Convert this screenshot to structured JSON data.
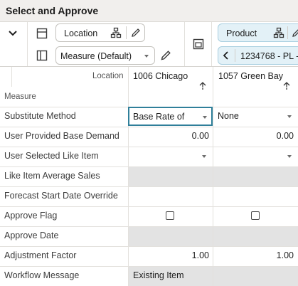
{
  "title": "Select and Approve",
  "toolbar": {
    "location_label": "Location",
    "measure_label": "Measure (Default)",
    "product_label": "Product",
    "product_value": "1234768 - PL -"
  },
  "grid": {
    "corner": {
      "location": "Location",
      "measure": "Measure"
    },
    "columns": [
      {
        "name": "1006 Chicago"
      },
      {
        "name": "1057 Green Bay"
      }
    ],
    "rows": {
      "substitute_method": {
        "label": "Substitute Method",
        "c1": "Base Rate of",
        "c2": "None"
      },
      "user_base_demand": {
        "label": "User Provided Base Demand",
        "c1": "0.00",
        "c2": "0.00"
      },
      "user_like_item": {
        "label": "User Selected Like Item"
      },
      "like_item_avg_sales": {
        "label": "Like Item Average Sales"
      },
      "forecast_start": {
        "label": "Forecast Start Date Override"
      },
      "approve_flag": {
        "label": "Approve Flag"
      },
      "approve_date": {
        "label": "Approve Date"
      },
      "adjustment_factor": {
        "label": "Adjustment Factor",
        "c1": "1.00",
        "c2": "1.00"
      },
      "workflow_message": {
        "label": "Workflow Message",
        "c1": "Existing Item",
        "c2": ""
      }
    }
  }
}
